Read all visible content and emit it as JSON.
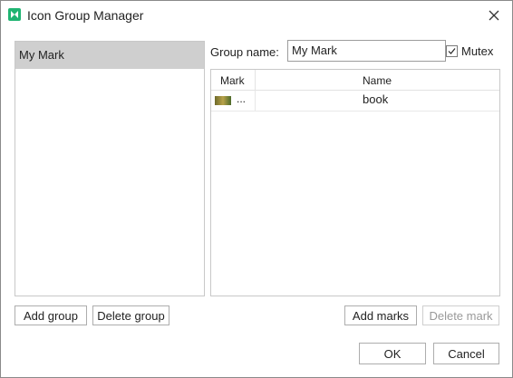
{
  "window": {
    "title": "Icon Group Manager"
  },
  "groups": [
    {
      "label": "My Mark",
      "selected": true
    }
  ],
  "group_name": {
    "label": "Group name:",
    "value": "My Mark"
  },
  "mutex": {
    "label": "Mutex",
    "checked": true
  },
  "marks_table": {
    "columns": [
      "Mark",
      "Name"
    ],
    "rows": [
      {
        "mark_icon": "image-thumbnail-icon",
        "mark_text": "...",
        "name": "book"
      }
    ]
  },
  "buttons": {
    "add_group": "Add group",
    "delete_group": "Delete group",
    "add_marks": "Add marks",
    "delete_mark": "Delete mark",
    "ok": "OK",
    "cancel": "Cancel"
  },
  "colors": {
    "app_icon": "#1fb472",
    "selected_row": "#cfcfcf"
  }
}
